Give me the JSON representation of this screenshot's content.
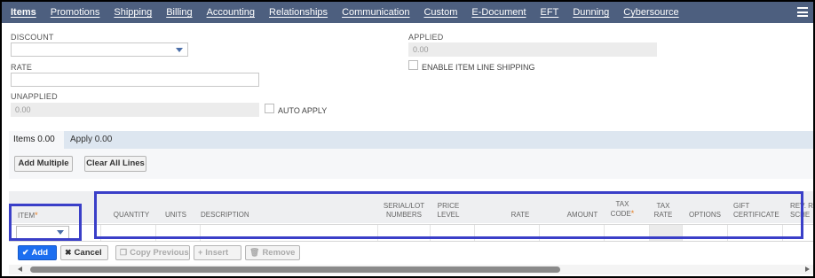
{
  "nav": {
    "tabs": [
      "Items",
      "Promotions",
      "Shipping",
      "Billing",
      "Accounting",
      "Relationships",
      "Communication",
      "Custom",
      "E-Document",
      "EFT",
      "Dunning",
      "Cybersource"
    ],
    "menu_icon": "hamburger-menu-icon"
  },
  "form": {
    "discount_label": "DISCOUNT",
    "discount_value": "",
    "rate_label": "RATE",
    "rate_value": "",
    "unapplied_label": "UNAPPLIED",
    "unapplied_value": "0.00",
    "auto_apply_label": "AUTO APPLY",
    "applied_label": "APPLIED",
    "applied_value": "0.00",
    "enable_item_line_shipping_label": "ENABLE ITEM LINE SHIPPING"
  },
  "subtabs": {
    "items_label": "Items 0.00",
    "apply_label": "Apply 0.00"
  },
  "sublist_buttons": {
    "add_multiple": "Add Multiple",
    "clear_all_lines": "Clear All Lines"
  },
  "columns": {
    "item": "ITEM",
    "quantity": "QUANTITY",
    "units": "UNITS",
    "description": "DESCRIPTION",
    "serial_lot_1": "SERIAL/LOT",
    "serial_lot_2": "NUMBERS",
    "price_level_1": "PRICE",
    "price_level_2": "LEVEL",
    "rate": "RATE",
    "amount": "AMOUNT",
    "tax_code_1": "TAX",
    "tax_code_2": "CODE",
    "tax_rate_1": "TAX",
    "tax_rate_2": "RATE",
    "options": "OPTIONS",
    "gift_certificate_1": "GIFT",
    "gift_certificate_2": "CERTIFICATE",
    "rev_rec_1": "REV. R",
    "rev_rec_2": "SCHE"
  },
  "actions": {
    "add": "Add",
    "cancel": "Cancel",
    "copy_previous": "Copy Previous",
    "insert": "Insert",
    "remove": "Remove"
  },
  "colors": {
    "nav_bg": "#4d5f7f",
    "primary_button": "#1c6ef0",
    "highlight_border": "#3a3fc8",
    "required_marker": "#e67e22"
  }
}
